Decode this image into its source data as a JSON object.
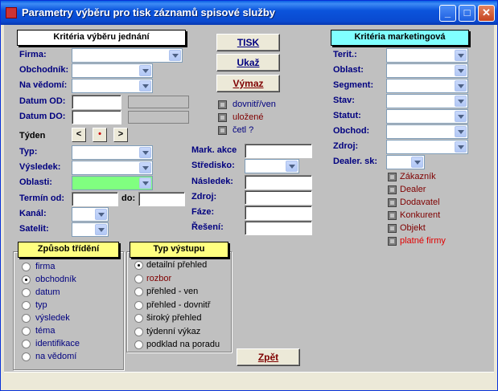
{
  "window": {
    "title": "Parametry výběru pro tisk záznamů spisové služby",
    "minimize": "_",
    "maximize": "□",
    "close": "✕"
  },
  "left_header": "Kritéria výběru jednání",
  "labels": {
    "firma": "Firma:",
    "obchodnik": "Obchodník:",
    "na_vedomi": "Na vědomí:",
    "datum_od": "Datum OD:",
    "datum_do": "Datum DO:",
    "tyden": "Týden",
    "typ": "Typ:",
    "vysledek": "Výsledek:",
    "oblasti": "Oblasti:",
    "termin_od": "Termín od:",
    "do": "do:",
    "kanal": "Kanál:",
    "satelit": "Satelit:",
    "mark_akce": "Mark. akce",
    "stredisko": "Středisko:",
    "nasledek": "Následek:",
    "zdroj": "Zdroj:",
    "faze": "Fáze:",
    "reseni": "Řešení:"
  },
  "week_buttons": {
    "prev": "<",
    "today": "•",
    "next": ">"
  },
  "buttons": {
    "tisk": "TISK",
    "ukaz": "Ukaž",
    "vymaz": "Výmaz",
    "zpet": "Zpět"
  },
  "middle_checks": [
    {
      "label": "dovnitř/ven",
      "color": "#00007f"
    },
    {
      "label": "uložené",
      "color": "#7f0000"
    },
    {
      "label": "četl ?",
      "color": "#00007f"
    }
  ],
  "marketing": {
    "header": "Kritéria marketingová",
    "labels": [
      "Terit.:",
      "Oblast:",
      "Segment:",
      "Stav:",
      "Statut:",
      "Obchod:",
      "Zdroj:",
      "Dealer. sk:"
    ],
    "checks": [
      "Zákazník",
      "Dealer",
      "Dodavatel",
      "Konkurent",
      "Objekt",
      "platné firmy"
    ]
  },
  "sort": {
    "header": "Způsob třídění",
    "options": [
      "firma",
      "obchodník",
      "datum",
      "typ",
      "výsledek",
      "téma",
      "identifikace",
      "na vědomí"
    ],
    "selected": 1
  },
  "output": {
    "header": "Typ výstupu",
    "options": [
      "detailní přehled",
      "rozbor",
      "přehled - ven",
      "přehled - dovnitř",
      "široký přehled",
      "týdenní výkaz",
      "podklad na poradu"
    ],
    "selected": 0
  },
  "colors": {
    "label_blue": "#00007f",
    "dark_red": "#7f0000",
    "highlight_green": "#80ff80",
    "header_cyan": "#80ffff",
    "header_yellow": "#ffff80"
  }
}
